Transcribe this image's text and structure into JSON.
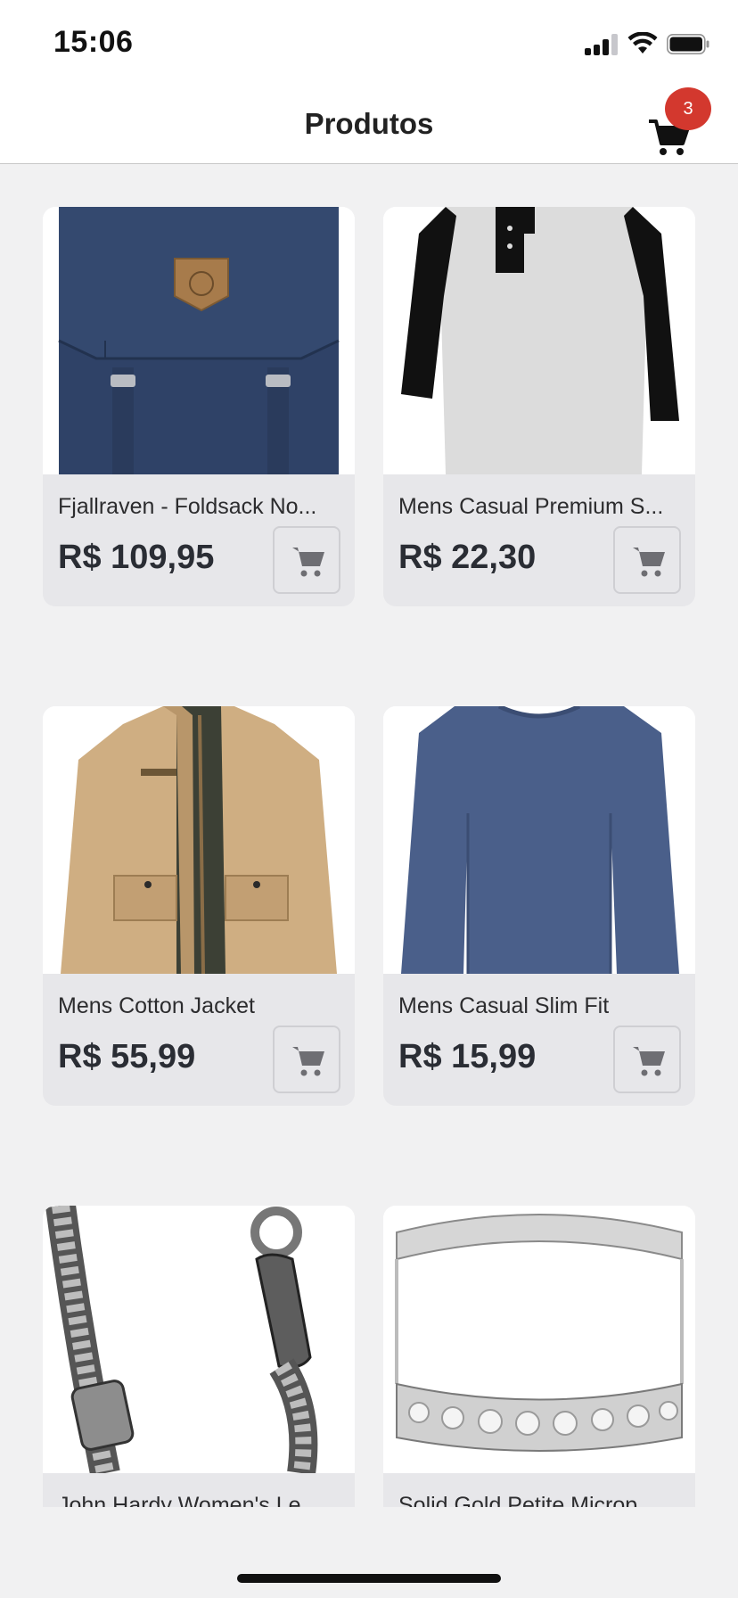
{
  "status_bar": {
    "time": "15:06",
    "signal_icon": "cellular-signal-icon",
    "wifi_icon": "wifi-icon",
    "battery_icon": "battery-icon"
  },
  "nav": {
    "title": "Produtos",
    "cart_icon": "cart-icon",
    "cart_count": "3",
    "badge_color": "#d3382e"
  },
  "products": [
    {
      "name": "Fjallraven - Foldsack No...",
      "price": "R$ 109,95",
      "image": "navy-backpack-image"
    },
    {
      "name": "Mens Casual Premium S...",
      "price": "R$ 22,30",
      "image": "raglan-henley-shirt-image"
    },
    {
      "name": "Mens Cotton Jacket",
      "price": "R$ 55,99",
      "image": "khaki-cotton-jacket-image"
    },
    {
      "name": "Mens Casual Slim Fit",
      "price": "R$ 15,99",
      "image": "blue-long-sleeve-shirt-image"
    },
    {
      "name": "John Hardy Women's Le...",
      "price": "",
      "image": "silver-chain-bracelet-image"
    },
    {
      "name": "Solid Gold Petite Microp...",
      "price": "",
      "image": "diamond-ring-image"
    }
  ],
  "colors": {
    "background": "#f1f1f2",
    "card_footer": "#e7e7ea",
    "price_text": "#2a2d34"
  }
}
